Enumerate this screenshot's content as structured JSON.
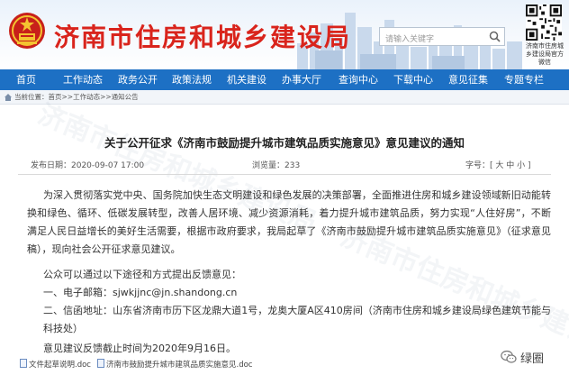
{
  "header": {
    "site_title": "济南市住房和城乡建设局",
    "search_placeholder": "请输入关键字",
    "qr_caption": "济南市住房城乡建设局官方微信"
  },
  "nav": {
    "items": [
      "首页",
      "工作动态",
      "政务公开",
      "政策法规",
      "机关建设",
      "办事大厅",
      "查询中心",
      "下载中心",
      "意见征集",
      "专题专栏"
    ]
  },
  "breadcrumb": "当前位置：首页>>工作动态>>通知公告",
  "article": {
    "title": "关于公开征求《济南市鼓励提升城市建筑品质实施意见》意见建议的通知",
    "publish_time": "发布日期：2020-09-07 17:00",
    "views_label": "浏览量：",
    "views": "233",
    "font_size_label": "字号：",
    "font_size_options": "[ 大 中 小 ]",
    "paragraphs": [
      "为深入贯彻落实党中央、国务院加快生态文明建设和绿色发展的决策部署，全面推进住房和城乡建设领域新旧动能转换和绿色、循环、低碳发展转型，改善人居环境、减少资源消耗，着力提升城市建筑品质，努力实现“人住好房”，不断满足人民日益增长的美好生活需要，根据市政府要求，我局起草了《济南市鼓励提升城市建筑品质实施意见》（征求意见稿），现向社会公开征求意见建议。",
      "公众可以通过以下途径和方式提出反馈意见：",
      "一、电子邮箱：sjwkjjnc@jn.shandong.cn",
      "二、信函地址：山东省济南市历下区龙鼎大道1号，龙奥大厦A区410房间（济南市住房和城乡建设局绿色建筑节能与科技处）",
      "意见建议反馈截止时间为2020年9月16日。"
    ],
    "attachments": [
      "文件起草说明.doc",
      "济南市鼓励提升城市建筑品质实施意见.doc"
    ]
  },
  "wechat_label": "绿圈",
  "colors": {
    "nav_bg": "#1d70c4",
    "title_red": "#d9241c"
  }
}
